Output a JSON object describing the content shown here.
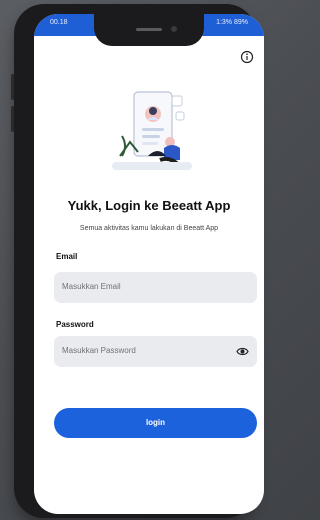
{
  "status": {
    "time": "00.18",
    "right": "1:3% 89%"
  },
  "header": {
    "title": "Yukk, Login ke Beeatt App",
    "subtitle": "Semua aktivitas kamu lakukan di Beeatt App"
  },
  "form": {
    "email_label": "Email",
    "email_placeholder": "Masukkan Email",
    "password_label": "Password",
    "password_placeholder": "Masukkan Password",
    "login_label": "login"
  },
  "colors": {
    "primary": "#1c62dc",
    "field_bg": "#e9ebef"
  }
}
